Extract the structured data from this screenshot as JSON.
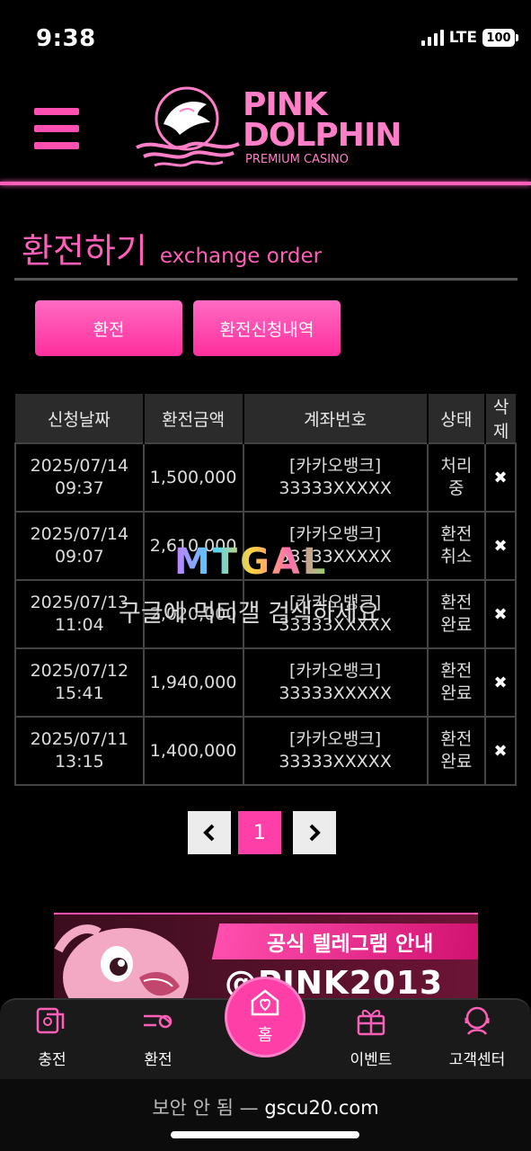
{
  "status_bar": {
    "time": "9:38",
    "network": "LTE",
    "battery": "100"
  },
  "header": {
    "logo_line1": "PINK",
    "logo_line2": "DOLPHIN",
    "logo_sub": "PREMIUM CASINO",
    "accent_color": "#ff5fb8"
  },
  "page": {
    "title_ko": "환전하기",
    "title_en": "exchange order"
  },
  "tabs": {
    "exchange": "환전",
    "history": "환전신청내역"
  },
  "table": {
    "headers": {
      "date": "신청날짜",
      "amount": "환전금액",
      "account": "계좌번호",
      "status": "상태",
      "delete_line1": "삭",
      "delete_line2": "제"
    },
    "rows": [
      {
        "date": "2025/07/14",
        "time": "09:37",
        "amount": "1,500,000",
        "bank": "[카카오뱅크]",
        "account": "33333XXXXX",
        "status1": "처리",
        "status2": "중",
        "del": "✖"
      },
      {
        "date": "2025/07/14",
        "time": "09:07",
        "amount": "2,610,000",
        "bank": "[카카오뱅크]",
        "account": "33333XXXXX",
        "status1": "환전",
        "status2": "취소",
        "del": "✖"
      },
      {
        "date": "2025/07/13",
        "time": "11:04",
        "amount": "2,020,000",
        "bank": "[카카오뱅크]",
        "account": "33333XXXXX",
        "status1": "환전",
        "status2": "완료",
        "del": "✖"
      },
      {
        "date": "2025/07/12",
        "time": "15:41",
        "amount": "1,940,000",
        "bank": "[카카오뱅크]",
        "account": "33333XXXXX",
        "status1": "환전",
        "status2": "완료",
        "del": "✖"
      },
      {
        "date": "2025/07/11",
        "time": "13:15",
        "amount": "1,400,000",
        "bank": "[카카오뱅크]",
        "account": "33333XXXXX",
        "status1": "환전",
        "status2": "완료",
        "del": "✖"
      }
    ]
  },
  "pagination": {
    "prev": "‹",
    "current": "1",
    "next": "›"
  },
  "banner": {
    "notice": "공식 텔레그램 안내",
    "handle": "@PINK2013"
  },
  "watermark": {
    "logo": "MTGAL",
    "text": "구글에 먹티갤 검색하세요"
  },
  "bottom_nav": {
    "deposit": "충전",
    "exchange": "환전",
    "home": "홈",
    "event": "이벤트",
    "support": "고객센터"
  },
  "browser": {
    "insecure": "보안 안 됨 —",
    "host": "gscu20.com"
  }
}
